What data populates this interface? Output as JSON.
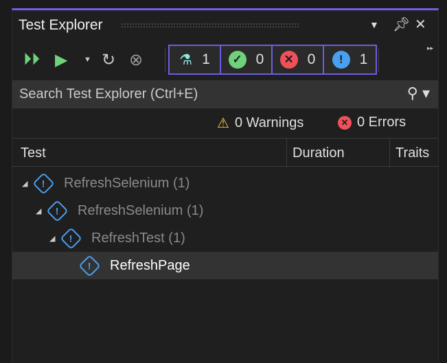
{
  "title": "Test Explorer",
  "counts": {
    "total": "1",
    "passed": "0",
    "failed": "0",
    "not_run": "1"
  },
  "search": {
    "placeholder": "Search Test Explorer (Ctrl+E)"
  },
  "status": {
    "warnings": "0 Warnings",
    "errors": "0 Errors"
  },
  "columns": {
    "test": "Test",
    "duration": "Duration",
    "traits": "Traits"
  },
  "tree": [
    {
      "label": "RefreshSelenium",
      "count": "(1)"
    },
    {
      "label": "RefreshSelenium",
      "count": "(1)"
    },
    {
      "label": "RefreshTest",
      "count": "(1)"
    },
    {
      "label": "RefreshPage"
    }
  ],
  "colors": {
    "accent": "#7160e8",
    "pass": "#6fd27a",
    "fail": "#f0505a",
    "info": "#4aa0f0"
  }
}
